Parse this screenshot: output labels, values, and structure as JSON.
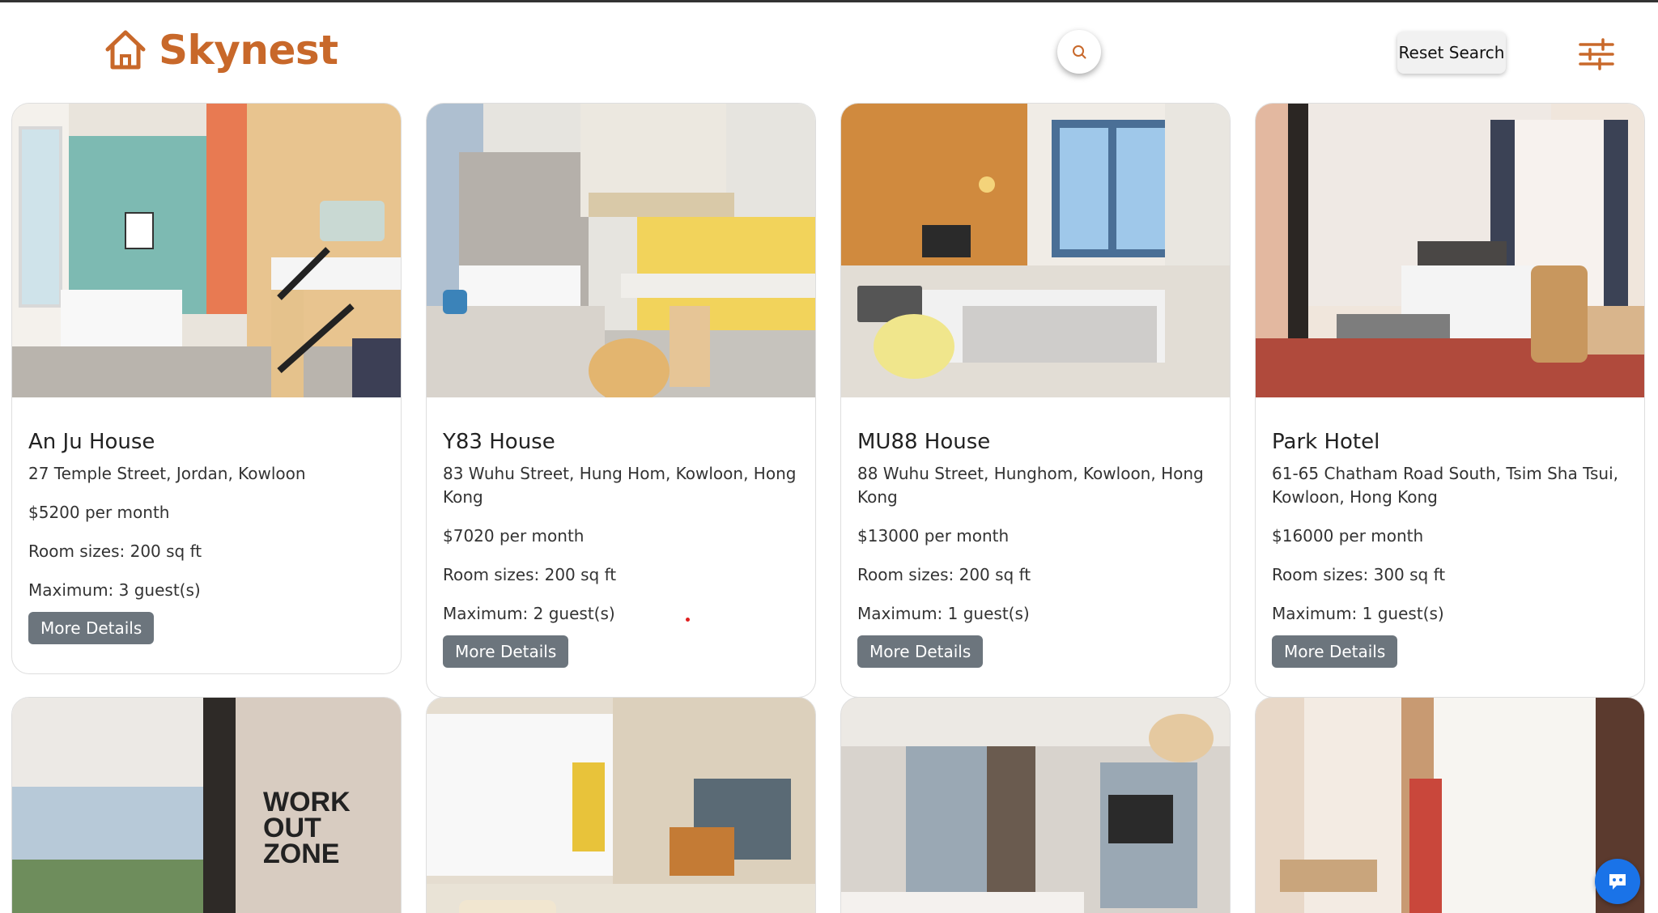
{
  "app": {
    "brand": "Skynest",
    "brand_color": "#c8682a"
  },
  "header": {
    "search_icon": "search-icon",
    "reset_label": "Reset Search",
    "filter_icon": "sliders-icon"
  },
  "listings": [
    {
      "name": "An Ju House",
      "address": "27 Temple Street, Jordan, Kowloon",
      "price": "$5200 per month",
      "size": "Room sizes: 200 sq ft",
      "guests": "Maximum: 3 guest(s)",
      "button": "More Details"
    },
    {
      "name": "Y83 House",
      "address": "83 Wuhu Street, Hung Hom, Kowloon, Hong Kong",
      "price": "$7020 per month",
      "size": "Room sizes: 200 sq ft",
      "guests": "Maximum: 2 guest(s)",
      "button": "More Details"
    },
    {
      "name": "MU88 House",
      "address": "88 Wuhu Street, Hunghom, Kowloon, Hong Kong",
      "price": "$13000 per month",
      "size": "Room sizes: 200 sq ft",
      "guests": "Maximum: 1 guest(s)",
      "button": "More Details"
    },
    {
      "name": "Park Hotel",
      "address": "61-65 Chatham Road South, Tsim Sha Tsui, Kowloon, Hong Kong",
      "price": "$16000 per month",
      "size": "Room sizes: 300 sq ft",
      "guests": "Maximum: 1 guest(s)",
      "button": "More Details"
    }
  ],
  "second_row": {
    "card1_wall_text": "WORK OUT ZONE"
  },
  "chat": {
    "icon": "chat-bot-icon",
    "color": "#1a73e8"
  }
}
